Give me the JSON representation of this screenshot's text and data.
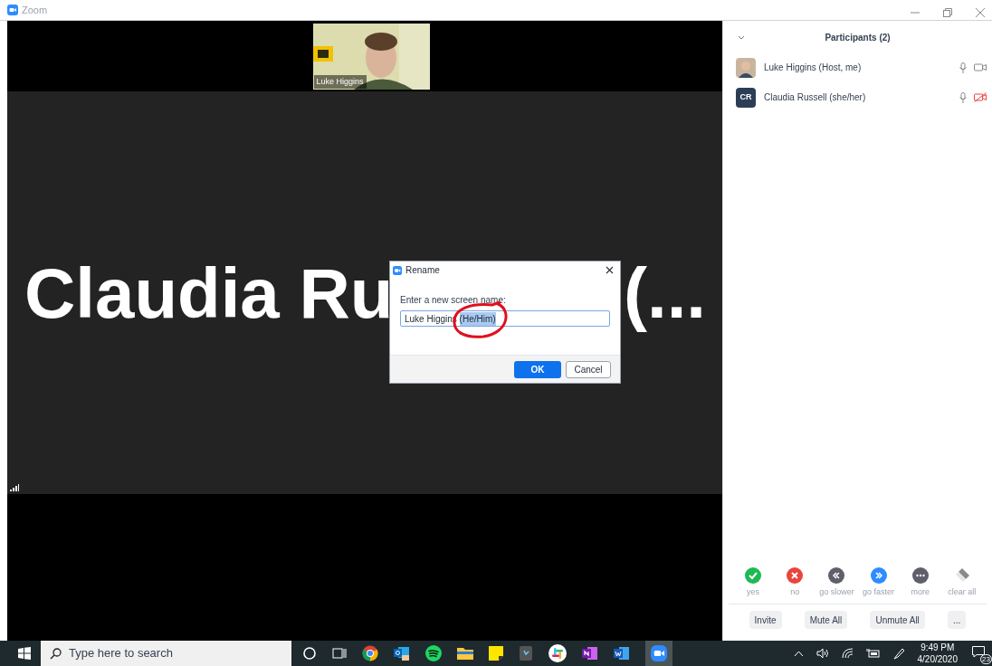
{
  "window": {
    "title": "Zoom"
  },
  "video": {
    "thumbnail_name": "Luke Higgins",
    "speaker_left": "Claudia Ru",
    "speaker_right": "(..."
  },
  "dialog": {
    "title": "Rename",
    "prompt": "Enter a new screen name:",
    "value": "Luke Higgins ",
    "selected_text": "(He/Him)",
    "ok": "OK",
    "cancel": "Cancel"
  },
  "participants": {
    "title": "Participants (2)",
    "items": [
      {
        "name": "Luke Higgins (Host, me)",
        "video_off": false
      },
      {
        "name": "Claudia Russell (she/her)",
        "kind": "initials",
        "initials": "CR",
        "video_off": true
      }
    ]
  },
  "reactions": [
    {
      "kind": "yes",
      "label": "yes",
      "color": "#1db954"
    },
    {
      "kind": "no",
      "label": "no",
      "color": "#e8453c"
    },
    {
      "kind": "slower",
      "label": "go slower",
      "color": "#5f5f6b"
    },
    {
      "kind": "faster",
      "label": "go faster",
      "color": "#2d8cff"
    },
    {
      "kind": "more",
      "label": "more",
      "color": "#5f5f6b"
    },
    {
      "kind": "clear",
      "label": "clear all",
      "color": "#8a8a8a"
    }
  ],
  "panel_buttons": [
    "Invite",
    "Mute All",
    "Unmute All",
    "..."
  ],
  "taskbar": {
    "search_placeholder": "Type here to search",
    "time": "9:49 PM",
    "date": "4/20/2020",
    "notifications": "23"
  }
}
